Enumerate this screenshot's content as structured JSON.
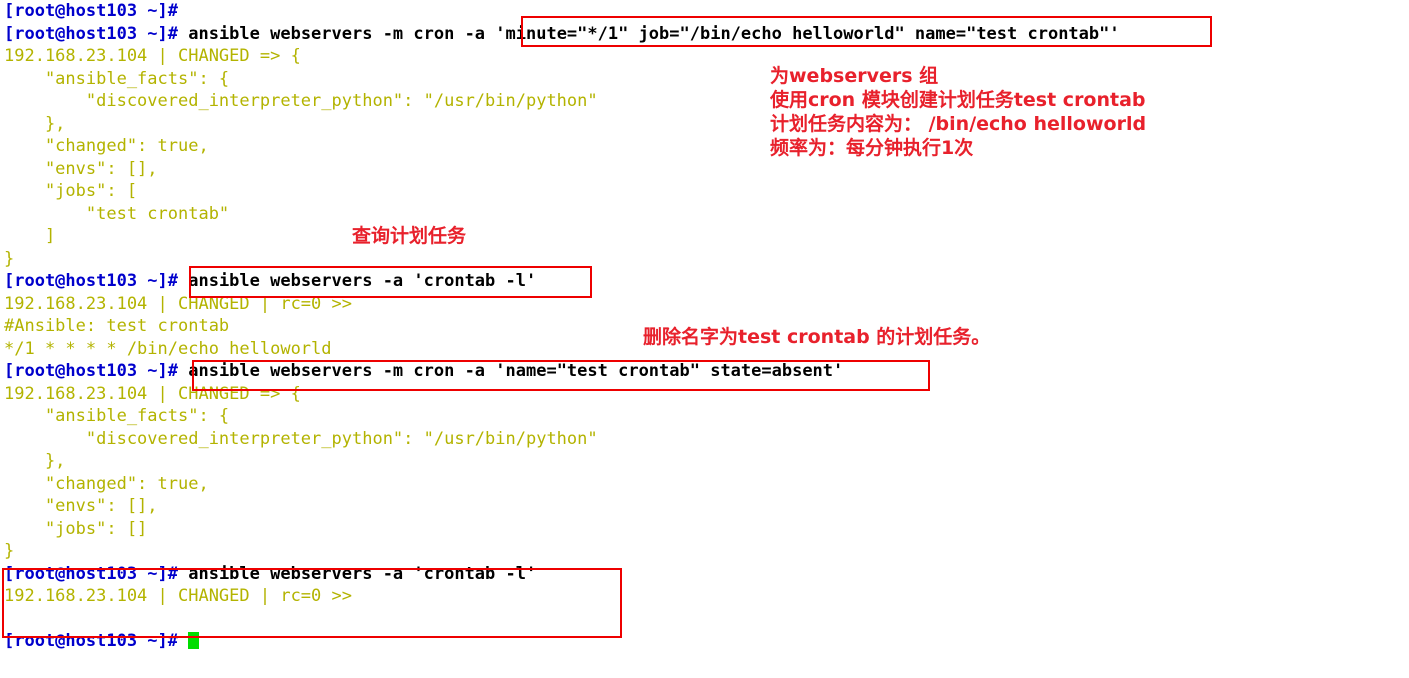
{
  "terminal": {
    "prompt": "[root@host103 ~]#",
    "host_ip": "192.168.23.104",
    "background_color": "#ffffff",
    "prompt_color": "#0000cc",
    "command_color": "#000000",
    "output_color": "#b3b300",
    "annotation_color": "#e8212c",
    "box_color": "#ee0000",
    "cursor_color": "#00dd00",
    "lines": [
      {
        "type": "prompt_only",
        "prompt": "[root@host103 ~]#",
        "command": ""
      },
      {
        "type": "command",
        "prompt": "[root@host103 ~]#",
        "command": " ansible webservers -m cron -a 'minute=\"*/1\" job=\"/bin/echo helloworld\" name=\"test crontab\"'"
      },
      {
        "type": "output",
        "text": "192.168.23.104 | CHANGED => {"
      },
      {
        "type": "output",
        "text": "    \"ansible_facts\": {"
      },
      {
        "type": "output",
        "text": "        \"discovered_interpreter_python\": \"/usr/bin/python\""
      },
      {
        "type": "output",
        "text": "    },"
      },
      {
        "type": "output",
        "text": "    \"changed\": true,"
      },
      {
        "type": "output",
        "text": "    \"envs\": [],"
      },
      {
        "type": "output",
        "text": "    \"jobs\": ["
      },
      {
        "type": "output",
        "text": "        \"test crontab\""
      },
      {
        "type": "output",
        "text": "    ]"
      },
      {
        "type": "output",
        "text": "}"
      },
      {
        "type": "command",
        "prompt": "[root@host103 ~]#",
        "command": " ansible webservers -a 'crontab -l'"
      },
      {
        "type": "output",
        "text": "192.168.23.104 | CHANGED | rc=0 >>"
      },
      {
        "type": "output",
        "text": "#Ansible: test crontab"
      },
      {
        "type": "output",
        "text": "*/1 * * * * /bin/echo helloworld"
      },
      {
        "type": "command",
        "prompt": "[root@host103 ~]#",
        "command": " ansible webservers -m cron -a 'name=\"test crontab\" state=absent'"
      },
      {
        "type": "output",
        "text": "192.168.23.104 | CHANGED => {"
      },
      {
        "type": "output",
        "text": "    \"ansible_facts\": {"
      },
      {
        "type": "output",
        "text": "        \"discovered_interpreter_python\": \"/usr/bin/python\""
      },
      {
        "type": "output",
        "text": "    },"
      },
      {
        "type": "output",
        "text": "    \"changed\": true,"
      },
      {
        "type": "output",
        "text": "    \"envs\": [],"
      },
      {
        "type": "output",
        "text": "    \"jobs\": []"
      },
      {
        "type": "output",
        "text": "}"
      },
      {
        "type": "command",
        "prompt": "[root@host103 ~]#",
        "command": " ansible webservers -a 'crontab -l'"
      },
      {
        "type": "output",
        "text": "192.168.23.104 | CHANGED | rc=0 >>"
      },
      {
        "type": "output",
        "text": ""
      },
      {
        "type": "prompt_cursor",
        "prompt": "[root@host103 ~]#",
        "command": " "
      }
    ]
  },
  "annotations": {
    "create_task": "为webservers 组\n使用cron 模块创建计划任务test crontab\n计划任务内容为： /bin/echo helloworld\n频率为：每分钟执行1次",
    "query_task": "查询计划任务",
    "delete_task": "删除名字为test crontab 的计划任务。"
  },
  "highlight_boxes": [
    {
      "label": "cron-create-args-box"
    },
    {
      "label": "crontab-list-command-box"
    },
    {
      "label": "cron-absent-command-box"
    },
    {
      "label": "crontab-list-empty-result-box"
    }
  ]
}
